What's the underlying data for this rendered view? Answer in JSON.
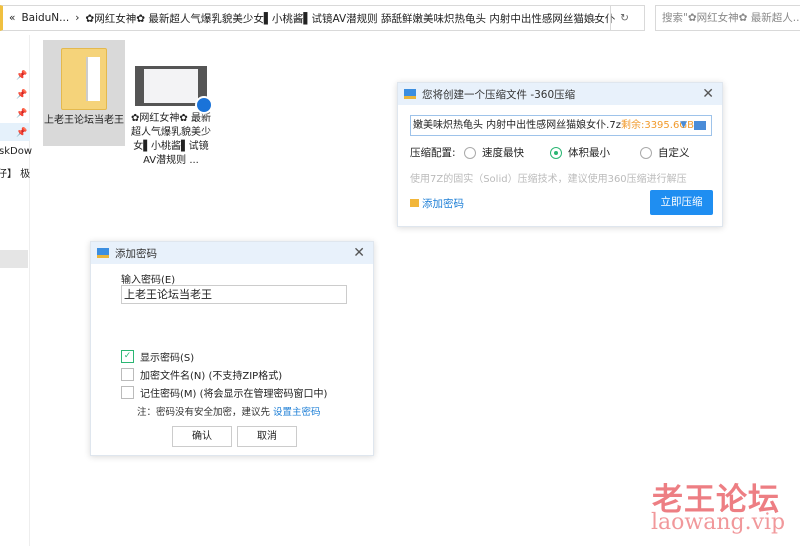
{
  "address_bar": {
    "back_glyph": "«",
    "crumbs": [
      "BaiduN...",
      "›",
      "✿网红女神✿ 最新超人气爆乳貌美少女▌小桃酱▌试镜AV潜规则 舔舐鲜嫩美味炽热龟头 内射中出性感网丝猫娘女仆"
    ],
    "dropdown": "⌄",
    "refresh": "↻"
  },
  "search": {
    "placeholder": "搜索\"✿网红女神✿ 最新超人..."
  },
  "sidebar": {
    "texts": [
      "skDow",
      "仔】 极"
    ],
    "pin": "📌"
  },
  "files": [
    {
      "name": "上老王论坛当老王",
      "type": "folder"
    },
    {
      "name": "✿网红女神✿ 最新超人气爆乳貌美少女▌小桃酱▌试镜AV潜规则 ...",
      "type": "video"
    }
  ],
  "compress_dialog": {
    "title": "您将创建一个压缩文件 -360压缩",
    "path": "嫩美味炽热龟头 内射中出性感网丝猫娘女仆.7z",
    "free": "剩余:3395.6GB",
    "config_label": "压缩配置:",
    "options": [
      {
        "label": "速度最快",
        "selected": false
      },
      {
        "label": "体积最小",
        "selected": true
      },
      {
        "label": "自定义",
        "selected": false
      }
    ],
    "hint": "使用7Z的固实（Solid）压缩技术，建议使用360压缩进行解压",
    "add_password": "添加密码",
    "compress_now": "立即压缩"
  },
  "password_dialog": {
    "title": "添加密码",
    "input_label": "输入密码(E)",
    "password": "上老王论坛当老王",
    "checkboxes": [
      {
        "label": "显示密码(S)",
        "checked": true
      },
      {
        "label": "加密文件名(N) (不支持ZIP格式)",
        "checked": false
      },
      {
        "label": "记住密码(M) (将会显示在管理密码窗口中)",
        "checked": false
      }
    ],
    "note": "注：密码没有安全加密，建议先",
    "note_link": "设置主密码",
    "ok": "确认",
    "cancel": "取消"
  },
  "watermark": {
    "cn": "老王论坛",
    "url": "laowang.vip"
  },
  "colors": {
    "accent": "#1f8ef1",
    "selected_radio": "#2bb673",
    "free_space": "#f19a2c",
    "watermark": "#e8545a"
  }
}
